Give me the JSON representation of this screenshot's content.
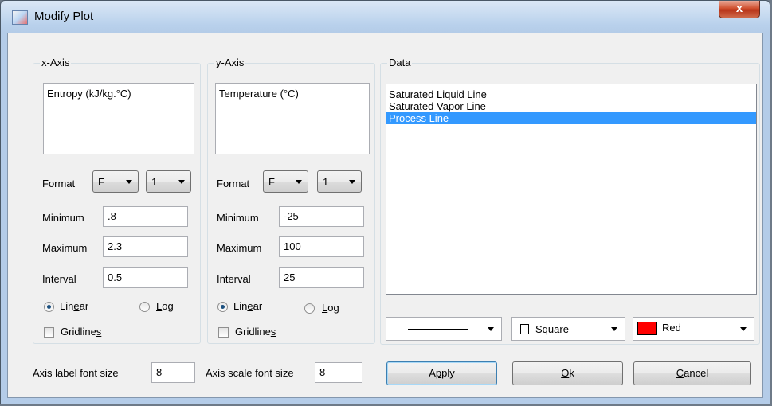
{
  "window": {
    "title": "Modify Plot",
    "close_glyph": "x"
  },
  "x_axis": {
    "group_title": "x-Axis",
    "label_text": "Entropy (kJ/kg.°C)",
    "format_label": "Format",
    "format_type": "F",
    "format_digits": "1",
    "minimum_label": "Minimum",
    "minimum": ".8",
    "maximum_label": "Maximum",
    "maximum": "2.3",
    "interval_label": "Interval",
    "interval": "0.5",
    "linear_pre": "Lin",
    "linear_u": "e",
    "linear_post": "ar",
    "log_pre": "",
    "log_u": "L",
    "log_post": "og",
    "scale": "linear",
    "gridlines_pre": "Gridline",
    "gridlines_u": "s",
    "gridlines_checked": false
  },
  "y_axis": {
    "group_title": "y-Axis",
    "label_text": "Temperature (°C)",
    "format_label": "Format",
    "format_type": "F",
    "format_digits": "1",
    "minimum_label": "Minimum",
    "minimum": "-25",
    "maximum_label": "Maximum",
    "maximum": "100",
    "interval_label": "Interval",
    "interval": "25",
    "linear_pre": "Lin",
    "linear_u": "e",
    "linear_post": "ar",
    "log_pre": "",
    "log_u": "L",
    "log_post": "og",
    "scale": "linear",
    "gridlines_pre": "Gridline",
    "gridlines_u": "s",
    "gridlines_checked": false
  },
  "data": {
    "group_title": "Data",
    "items": [
      "Saturated Liquid Line",
      "Saturated Vapor Line",
      "Process Line"
    ],
    "selected_index": 2,
    "line_style": "solid",
    "marker": "Square",
    "color_name": "Red",
    "color_hex": "#ff0000"
  },
  "footer": {
    "axis_label_font_size_label": "Axis label font size",
    "axis_label_font_size": "8",
    "axis_scale_font_size_label": "Axis scale font size",
    "axis_scale_font_size": "8"
  },
  "buttons": {
    "apply_pre": "A",
    "apply_u": "p",
    "apply_post": "ply",
    "ok_pre": "",
    "ok_u": "O",
    "ok_post": "k",
    "cancel_pre": "",
    "cancel_u": "C",
    "cancel_post": "ancel"
  }
}
